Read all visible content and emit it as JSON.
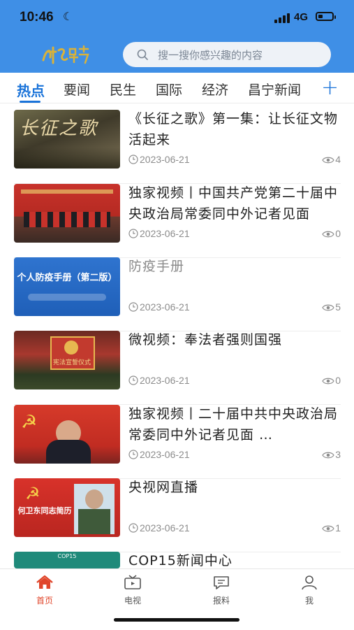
{
  "status": {
    "time": "10:46",
    "network": "4G"
  },
  "header": {
    "logo_alt": "昌宁",
    "search_placeholder": "搜一搜你感兴趣的内容"
  },
  "tabs": [
    {
      "label": "热点",
      "active": true
    },
    {
      "label": "要闻"
    },
    {
      "label": "民生"
    },
    {
      "label": "国际"
    },
    {
      "label": "经济"
    },
    {
      "label": "昌宁新闻"
    }
  ],
  "articles": [
    {
      "title": "《长征之歌》第一集：让长征文物活起来",
      "date": "2023-06-21",
      "views": "4",
      "thumb_text": "长征之歌",
      "muted": false
    },
    {
      "title": "独家视频丨中国共产党第二十届中央政治局常委同中外记者见面",
      "date": "2023-06-21",
      "views": "0",
      "thumb_text": "",
      "muted": false
    },
    {
      "title": "防疫手册",
      "date": "2023-06-21",
      "views": "5",
      "thumb_text": "个人防疫手册（第二版）",
      "muted": true
    },
    {
      "title": "微视频：奉法者强则国强",
      "date": "2023-06-21",
      "views": "0",
      "thumb_text": "宪法宣誓仪式",
      "muted": false
    },
    {
      "title": "独家视频丨二十届中共中央政治局常委同中外记者见面 …",
      "date": "2023-06-21",
      "views": "3",
      "thumb_text": "",
      "muted": false
    },
    {
      "title": "央视网直播",
      "date": "2023-06-21",
      "views": "1",
      "thumb_text": "何卫东同志简历",
      "muted": false
    },
    {
      "title": "COP15新闻中心",
      "date": "",
      "views": "",
      "thumb_text": "COP15",
      "muted": false
    }
  ],
  "bottom_nav": [
    {
      "label": "首页",
      "active": true
    },
    {
      "label": "电视"
    },
    {
      "label": "报料"
    },
    {
      "label": "我"
    }
  ],
  "colors": {
    "brand_blue": "#3f8fe6",
    "tab_active": "#1a73d9",
    "nav_active": "#e0452a"
  }
}
